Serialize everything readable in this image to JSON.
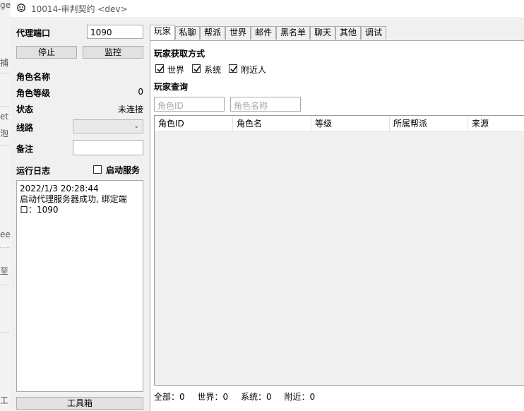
{
  "background_fragments": [
    "ge",
    "捕",
    "et",
    "泡",
    "ee",
    "至",
    "工"
  ],
  "window": {
    "title": "10014-审判契约 <dev>"
  },
  "left_panel": {
    "proxy_port_label": "代理端口",
    "proxy_port_value": "1090",
    "stop_button": "停止",
    "monitor_button": "监控",
    "role_name_label": "角色名称",
    "role_level_label": "角色等级",
    "role_level_value": "0",
    "status_label": "状态",
    "status_value": "未连接",
    "route_label": "线路",
    "note_label": "备注",
    "log_label": "运行日志",
    "start_service_label": "启动服务",
    "start_service_checked": false,
    "log_lines": [
      "2022/1/3 20:28:44",
      "启动代理服务器成功, 绑定端口：1090"
    ],
    "toolbox_button": "工具箱"
  },
  "tabs": [
    {
      "label": "玩家",
      "active": true
    },
    {
      "label": "私聊",
      "active": false
    },
    {
      "label": "帮派",
      "active": false
    },
    {
      "label": "世界",
      "active": false
    },
    {
      "label": "邮件",
      "active": false
    },
    {
      "label": "黑名单",
      "active": false
    },
    {
      "label": "聊天",
      "active": false
    },
    {
      "label": "其他",
      "active": false
    },
    {
      "label": "调试",
      "active": false
    }
  ],
  "player_tab": {
    "source_heading": "玩家获取方式",
    "sources": [
      {
        "label": "世界",
        "checked": true
      },
      {
        "label": "系统",
        "checked": true
      },
      {
        "label": "附近人",
        "checked": true
      }
    ],
    "query_heading": "玩家查询",
    "role_id_placeholder": "角色ID",
    "role_name_placeholder": "角色名称",
    "columns": [
      "角色ID",
      "角色名",
      "等级",
      "所属帮派",
      "来源"
    ],
    "rows": []
  },
  "status_bar": {
    "all_label": "全部：",
    "all_value": "0",
    "world_label": "世界：",
    "world_value": "0",
    "system_label": "系统：",
    "system_value": "0",
    "nearby_label": "附近：",
    "nearby_value": "0"
  }
}
